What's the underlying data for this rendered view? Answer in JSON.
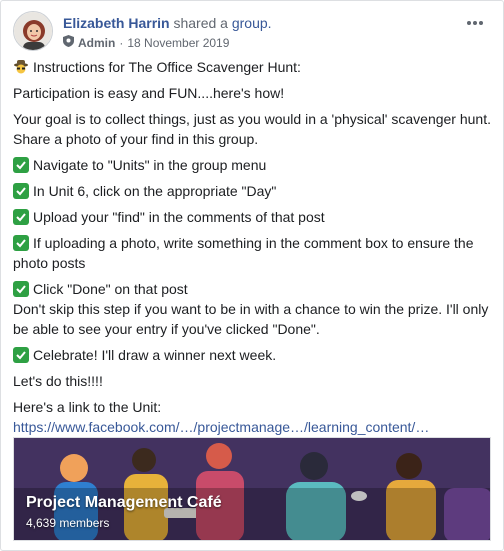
{
  "post": {
    "author": "Elizabeth Harrin",
    "action": "shared a",
    "shared_object": "group.",
    "role": "Admin",
    "date": "18 November 2019",
    "separator": "·"
  },
  "body": {
    "heading": "Instructions for The Office Scavenger Hunt:",
    "intro": "Participation is easy and FUN....here's how!",
    "goal": "Your goal is to collect things, just as you would in a 'physical' scavenger hunt. Share a photo of your find in this group.",
    "steps": [
      "Navigate to \"Units\" in the group menu",
      "In Unit 6, click on the appropriate \"Day\"",
      "Upload your \"find\" in the comments of that post",
      "If uploading a photo, write something in the comment box to ensure the photo posts",
      "Click \"Done\" on that post"
    ],
    "done_note": "Don't skip this step if you want to be in with a chance to win the prize. I'll only be able to see your entry if you've clicked \"Done\".",
    "celebrate": "Celebrate! I'll draw a winner next week.",
    "lets_do": "Let's do this!!!!",
    "link_prefix": "Here's a link to the Unit: ",
    "link_text": "https://www.facebook.com/…/projectmanage…/learning_content/…"
  },
  "shared_group": {
    "name": "Project Management Café",
    "members": "4,639 members"
  },
  "icons": {
    "check": "check-mark-icon",
    "spy": "detective-icon",
    "more": "more-options-icon",
    "shield": "admin-shield-icon"
  },
  "colors": {
    "link": "#385898",
    "check_green": "#2ea043",
    "banner_bg": "#3a2b55"
  }
}
